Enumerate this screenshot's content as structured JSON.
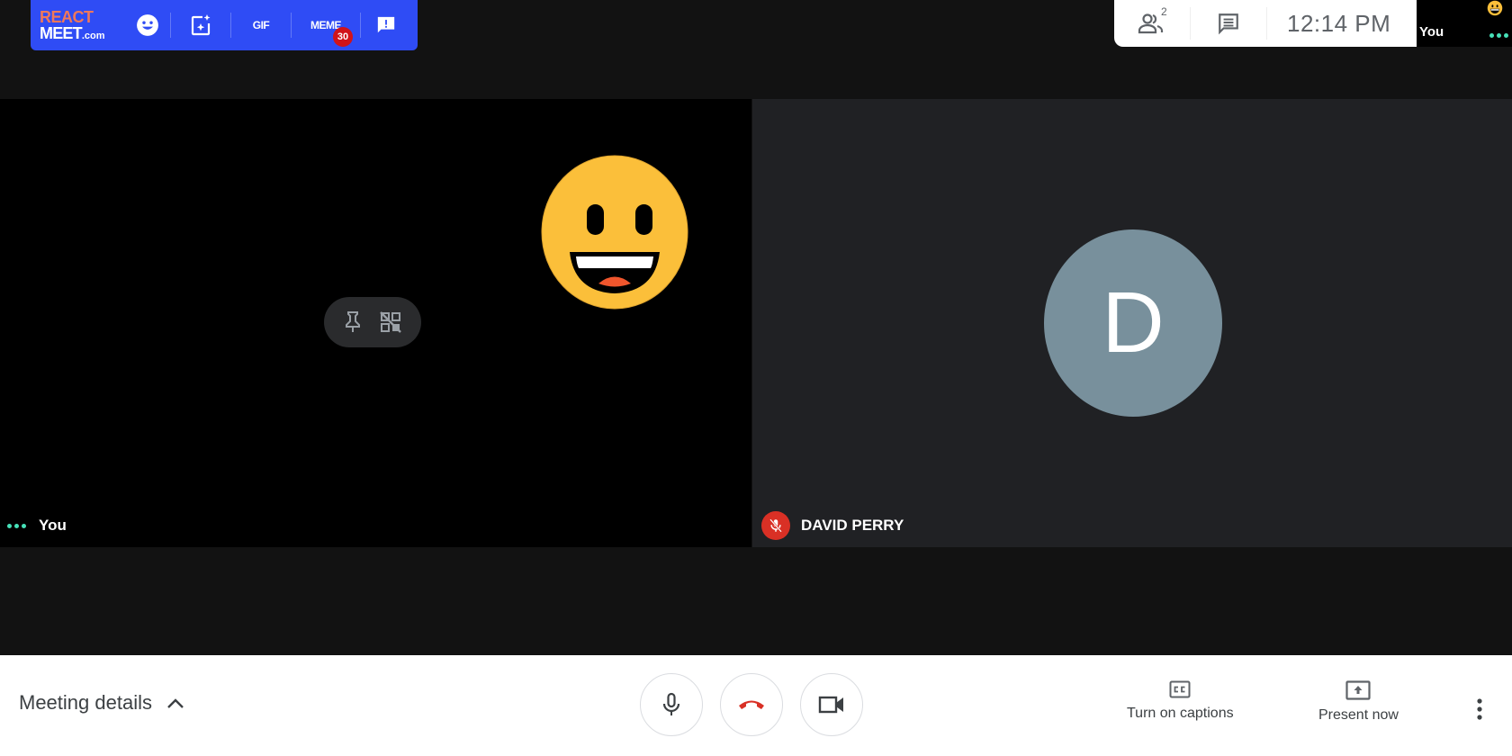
{
  "extension_bar": {
    "logo_line1": "REACT",
    "logo_line2": "MEET",
    "logo_suffix": ".com",
    "items": [
      {
        "icon": "smiley-icon",
        "label": ""
      },
      {
        "icon": "sparkle-frame-icon",
        "label": ""
      },
      {
        "icon": "gif-icon",
        "label": "GIF"
      },
      {
        "icon": "meme-icon",
        "label": "MEME",
        "badge": "30"
      },
      {
        "icon": "feedback-icon",
        "label": ""
      }
    ],
    "colors": {
      "background": "#2f4cf5",
      "logo_accent": "#f0785a",
      "badge": "#d1131a"
    }
  },
  "info_panel": {
    "people_count": "2",
    "time": "12:14 PM"
  },
  "self_preview": {
    "name": "You"
  },
  "tiles": {
    "self": {
      "name": "You",
      "reaction_emoji": "grinning-face"
    },
    "remote": {
      "name": "DAVID PERRY",
      "initial": "D",
      "muted": true,
      "avatar_color": "#78909c"
    }
  },
  "bottom_bar": {
    "meeting_details": "Meeting details",
    "captions_label": "Turn on captions",
    "present_label": "Present now",
    "hangup_color": "#d93025"
  }
}
